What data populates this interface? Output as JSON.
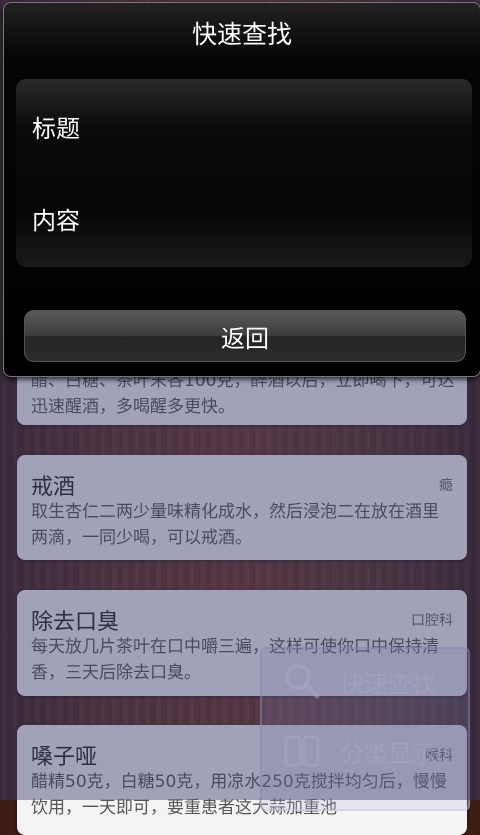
{
  "dialog": {
    "title": "快速查找",
    "options": [
      "标题",
      "内容"
    ],
    "back_label": "返回"
  },
  "cards": [
    {
      "title": "",
      "category": "",
      "body": "醋、白糖、茶叶末各100克，醉酒以后，立即喝下，可达迅速醒酒，多喝醒多更快。"
    },
    {
      "title": "戒酒",
      "category": "瘾",
      "body": "取生杏仁二两少量味精化成水，然后浸泡二在放在酒里两滴，一同少喝，可以戒酒。"
    },
    {
      "title": "除去口臭",
      "category": "口腔科",
      "body": "每天放几片茶叶在口中嚼三遍，这样可使你口中保持清香，三天后除去口臭。"
    },
    {
      "title": "嗓子哑",
      "category": "喉科",
      "body": "醋精50克，白糖50克，用凉水250克搅拌均匀后，慢慢饮用，一天即可，要重患者这大蒜加重池"
    }
  ],
  "float": {
    "search_label": "快速查找",
    "category_label": "分类显示",
    "search_icon": "search-icon",
    "category_icon": "book-icon"
  }
}
